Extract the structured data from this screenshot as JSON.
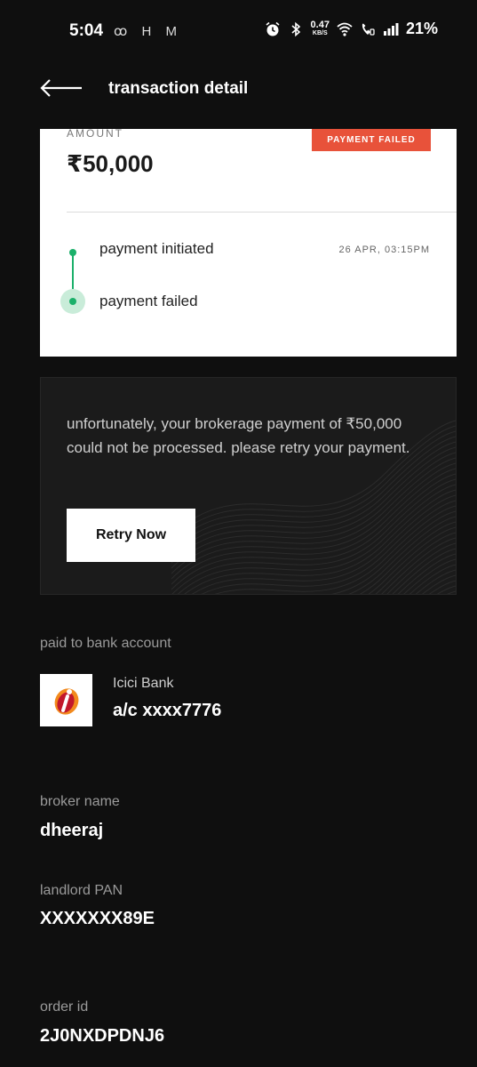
{
  "status_bar": {
    "time": "5:04",
    "app_icons": "ꝏ H M",
    "net_speed_value": "0.47",
    "net_speed_unit": "KB/S",
    "battery": "21%"
  },
  "header": {
    "title": "transaction detail"
  },
  "card": {
    "amount_label": "AMOUNT",
    "amount_value": "₹50,000",
    "status": "PAYMENT FAILED",
    "status_color": "#e8523a",
    "timeline": [
      {
        "label": "payment initiated",
        "time": "26 APR, 03:15PM"
      },
      {
        "label": "payment failed"
      }
    ],
    "timeline_color": "#1bb06a"
  },
  "notice": {
    "message": "unfortunately, your brokerage payment of ₹50,000 could not be processed. please retry your payment.",
    "retry_label": "Retry Now"
  },
  "details": {
    "paid_to_label": "paid to bank account",
    "bank_name": "Icici Bank",
    "account": "a/c xxxx7776",
    "broker_label": "broker name",
    "broker_value": "dheeraj",
    "pan_label": "landlord PAN",
    "pan_value": "XXXXXXX89E",
    "order_label": "order id",
    "order_value": "2J0NXDPDNJ6"
  }
}
